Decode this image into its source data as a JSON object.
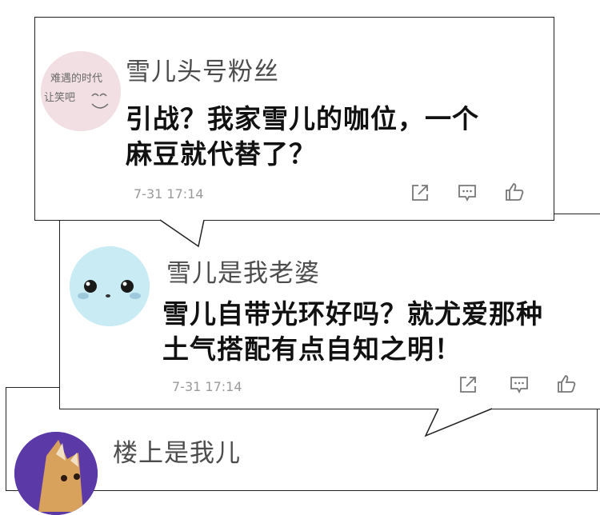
{
  "comments": [
    {
      "username": "雪儿头号粉丝",
      "avatar_text": [
        "难遇的时代",
        "让笑吧"
      ],
      "message_lines": [
        "引战？我家雪儿的咖位，一个",
        "麻豆就代替了？"
      ],
      "timestamp": "7-31 17:14",
      "action_icons": [
        "share-icon",
        "comment-icon",
        "like-icon"
      ]
    },
    {
      "username": "雪儿是我老婆",
      "message_lines": [
        "雪儿自带光环好吗？就尤爱那种",
        "土气搭配有点自知之明！"
      ],
      "timestamp": "7-31 17:14",
      "action_icons": [
        "share-icon",
        "comment-icon",
        "like-icon"
      ]
    },
    {
      "username": "楼上是我儿"
    }
  ],
  "colors": {
    "border": "#222222",
    "username": "#4c4c4c",
    "message": "#111111",
    "meta": "#9a9a9a",
    "avatar2": "#c9ecf4",
    "avatar3": "#5b3aa8"
  }
}
